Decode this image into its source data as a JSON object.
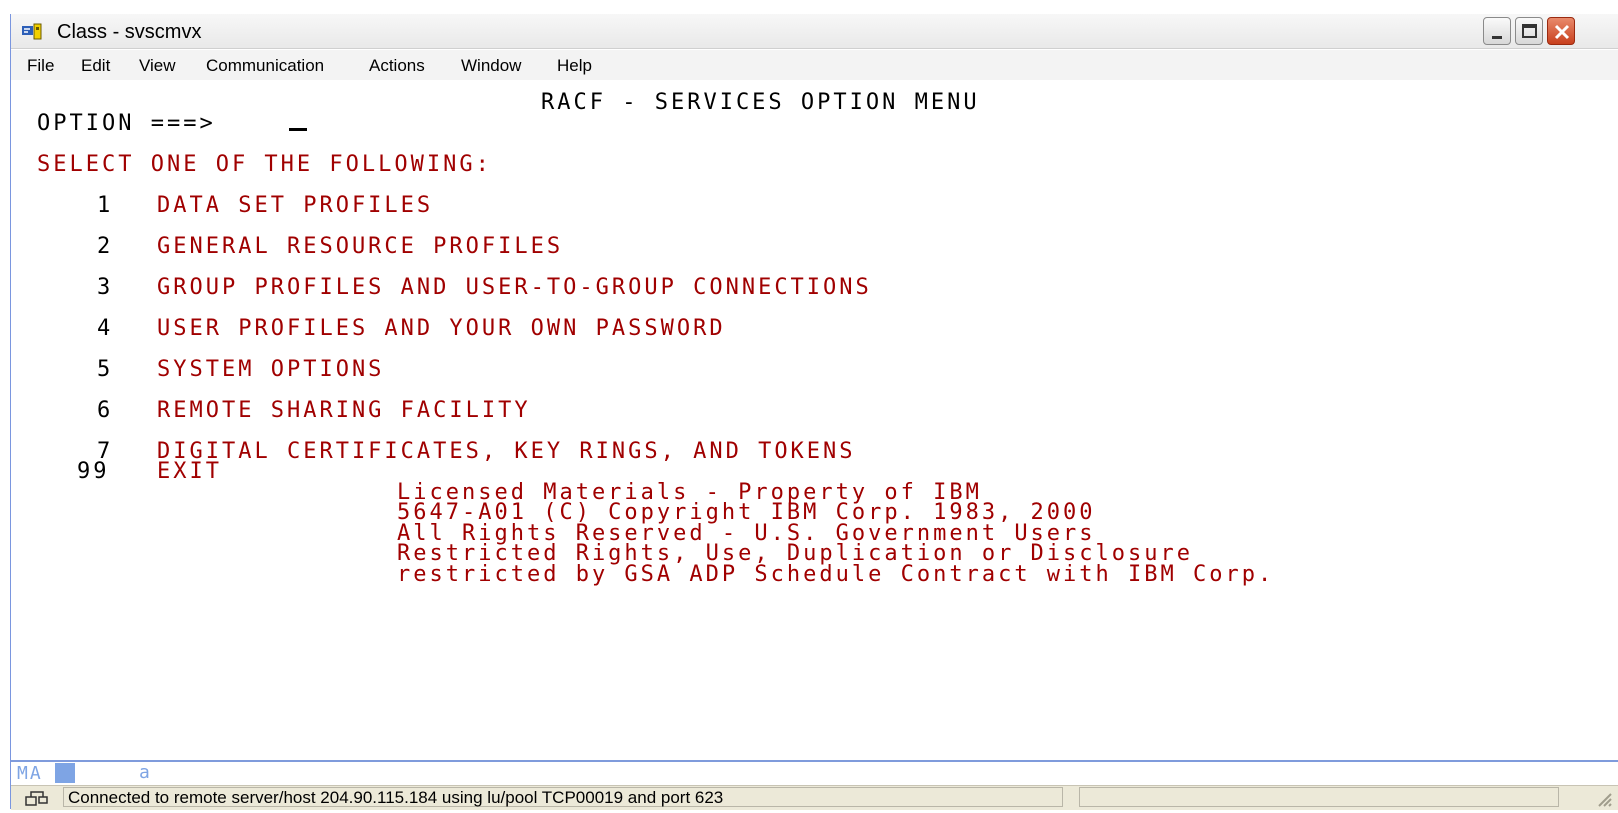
{
  "window": {
    "title": "Class - svscmvx",
    "icon": "terminal-app-icon",
    "controls": [
      "minimize-icon",
      "maximize-icon",
      "close-icon"
    ]
  },
  "menu": {
    "items": [
      "File",
      "Edit",
      "View",
      "Communication",
      "Actions",
      "Window",
      "Help"
    ]
  },
  "screen": {
    "heading": "RACF - SERVICES OPTION MENU",
    "option_prompt": "OPTION ===>",
    "option_value": "",
    "select_prompt": "SELECT ONE OF THE FOLLOWING:",
    "options": [
      {
        "num": "1",
        "label": "DATA SET PROFILES"
      },
      {
        "num": "2",
        "label": "GENERAL RESOURCE PROFILES"
      },
      {
        "num": "3",
        "label": "GROUP PROFILES AND USER-TO-GROUP CONNECTIONS"
      },
      {
        "num": "4",
        "label": "USER PROFILES AND YOUR OWN PASSWORD"
      },
      {
        "num": "5",
        "label": "SYSTEM OPTIONS"
      },
      {
        "num": "6",
        "label": "REMOTE SHARING FACILITY"
      },
      {
        "num": "7",
        "label": "DIGITAL CERTIFICATES, KEY RINGS, AND TOKENS"
      },
      {
        "num": "99",
        "label": "EXIT"
      }
    ],
    "copyright": [
      "Licensed Materials - Property of IBM",
      "5647-A01 (C) Copyright IBM Corp. 1983, 2000",
      "All Rights Reserved - U.S. Government Users",
      "Restricted Rights, Use, Duplication or Disclosure",
      "restricted by GSA ADP Schedule Contract with IBM Corp."
    ]
  },
  "oia": {
    "mode": "MA",
    "indicator": "a"
  },
  "status": {
    "text": "Connected to remote server/host 204.90.115.184 using lu/pool TCP00019 and port 623",
    "icon": "network-connection-icon"
  },
  "colors": {
    "text_red": "#a00000",
    "oia_blue": "#7ea4e4"
  }
}
